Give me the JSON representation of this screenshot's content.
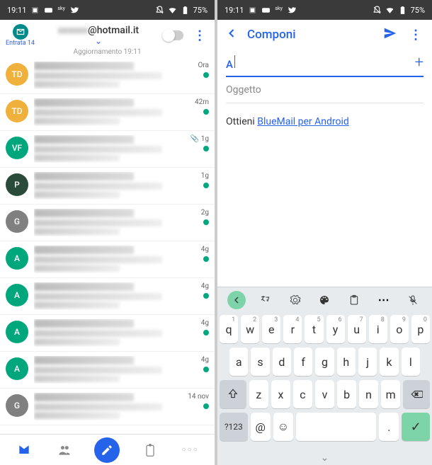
{
  "status": {
    "time": "19:11",
    "battery": "75%"
  },
  "left": {
    "badge_label": "Entrata",
    "badge_count": "14",
    "email_visible": "@hotmail.it",
    "update_text": "Aggiornamento 19:11",
    "items": [
      {
        "avatar_bg": "#f0b13c",
        "avatar_txt": "TD",
        "time": "Ora"
      },
      {
        "avatar_bg": "#f0b13c",
        "avatar_txt": "TD",
        "time": "42m"
      },
      {
        "avatar_bg": "#00a67c",
        "avatar_txt": "VF",
        "time": "1g",
        "attach": true
      },
      {
        "avatar_bg": "#2b4b3a",
        "avatar_txt": "P",
        "time": "1g"
      },
      {
        "avatar_bg": "#808080",
        "avatar_txt": "G",
        "time": "2g"
      },
      {
        "avatar_bg": "#00a67c",
        "avatar_txt": "A",
        "time": "4g"
      },
      {
        "avatar_bg": "#00a67c",
        "avatar_txt": "A",
        "time": "4g"
      },
      {
        "avatar_bg": "#00a67c",
        "avatar_txt": "A",
        "time": "4g"
      },
      {
        "avatar_bg": "#00a67c",
        "avatar_txt": "A",
        "time": "4g"
      },
      {
        "avatar_bg": "#808080",
        "avatar_txt": "G",
        "time": "14 nov"
      }
    ]
  },
  "right": {
    "title": "Componi",
    "to_value": "A",
    "subject_placeholder": "Oggetto",
    "body_prefix": "Ottieni ",
    "body_link": "BlueMail per Android"
  },
  "kb": {
    "row1": [
      {
        "k": "q",
        "n": "1"
      },
      {
        "k": "w",
        "n": "2"
      },
      {
        "k": "e",
        "n": "3"
      },
      {
        "k": "r",
        "n": "4"
      },
      {
        "k": "t",
        "n": "5"
      },
      {
        "k": "y",
        "n": "6"
      },
      {
        "k": "u",
        "n": "7"
      },
      {
        "k": "i",
        "n": "8"
      },
      {
        "k": "o",
        "n": "9"
      },
      {
        "k": "p",
        "n": "0"
      }
    ],
    "row2": [
      "a",
      "s",
      "d",
      "f",
      "g",
      "h",
      "j",
      "k",
      "l"
    ],
    "row3": [
      "z",
      "x",
      "c",
      "v",
      "b",
      "n",
      "m"
    ],
    "sym": "?123",
    "at": "@",
    "dot": "."
  }
}
